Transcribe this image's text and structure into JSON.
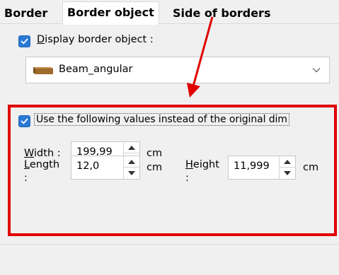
{
  "tabs": [
    {
      "label": "Border"
    },
    {
      "label": "Border object"
    },
    {
      "label": "Side of borders"
    }
  ],
  "display_checkbox": {
    "checked": true,
    "label_underline": "D",
    "label_rest": "isplay border object :"
  },
  "dropdown": {
    "value": "Beam_angular",
    "icon": "beam-icon"
  },
  "use_values_checkbox": {
    "checked": true,
    "label": "Use the following values instead of the original dim"
  },
  "fields": {
    "width": {
      "label_underline": "W",
      "label_rest": "idth :",
      "value": "199,99",
      "unit": "cm"
    },
    "length": {
      "label_underline": "L",
      "label_rest": "ength",
      "colon": ":",
      "value": "12,0",
      "unit": "cm"
    },
    "height": {
      "label_underline": "H",
      "label_rest": "eight",
      "colon": ":",
      "value": "11,999",
      "unit": "cm"
    }
  },
  "annotation": {
    "color": "#e00000"
  },
  "colors": {
    "accent": "#2a7ad6",
    "highlight": "#e00000"
  }
}
